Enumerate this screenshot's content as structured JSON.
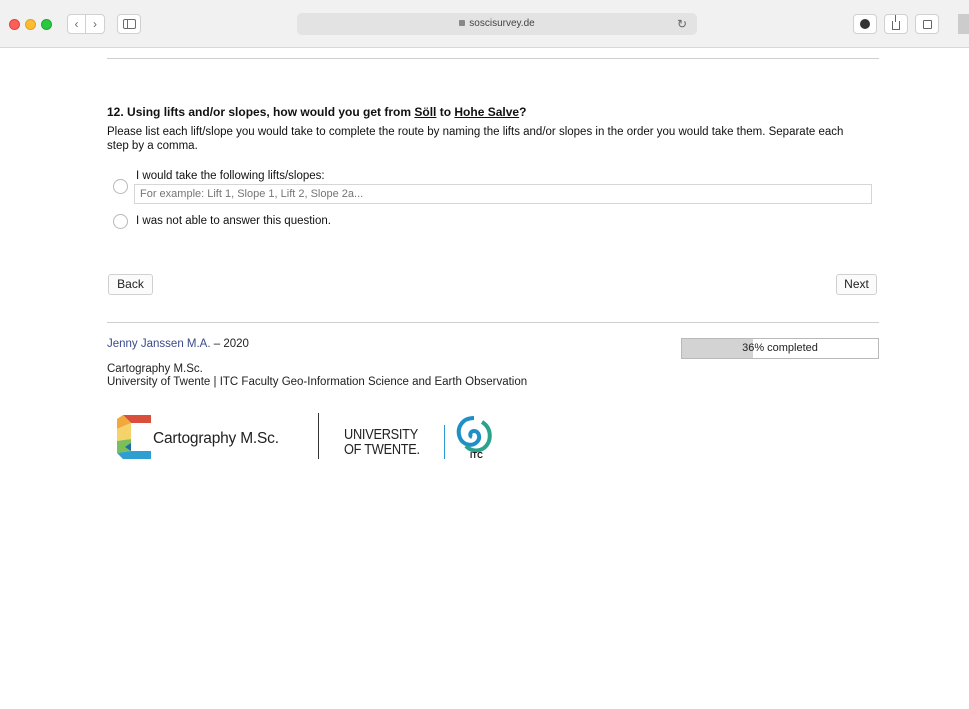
{
  "browser": {
    "url": "soscisurvey.de",
    "nav_back": "‹",
    "nav_forward": "›",
    "reload_icon": "↻"
  },
  "question": {
    "number": "12.",
    "title_prefix": "Using lifts and/or slopes, how would you get from ",
    "from": "Söll",
    "mid": " to ",
    "to": "Hohe Salve",
    "suffix": "?",
    "instruction": "Please list each lift/slope you would take to complete the route by naming the lifts and/or slopes in the order you would take them. Separate each step by a comma."
  },
  "options": {
    "option1_label": "I would take the following lifts/slopes:",
    "option1_placeholder": "For example: Lift 1, Slope 1, Lift 2, Slope 2a...",
    "option1_value": "",
    "option2_label": "I was not able to answer this question."
  },
  "buttons": {
    "back": "Back",
    "next": "Next"
  },
  "footer": {
    "author_name": "Jenny Janssen M.A.",
    "author_year": " – 2020",
    "progress_fraction": 0.36,
    "progress_text": "36% completed",
    "program_line1": "Cartography M.Sc.",
    "program_line2": "University of Twente | ITC Faculty Geo-Information Science and Earth Observation"
  },
  "logos": {
    "cartography_text": "Cartography M.Sc.",
    "ut_line1": "UNIVERSITY",
    "ut_line2": "OF TWENTE.",
    "itc_text": "ITC"
  },
  "colors": {
    "link": "#3a4a8a",
    "progress_fill": "#d3d3d3",
    "ut_divider": "#2a9ad0"
  }
}
